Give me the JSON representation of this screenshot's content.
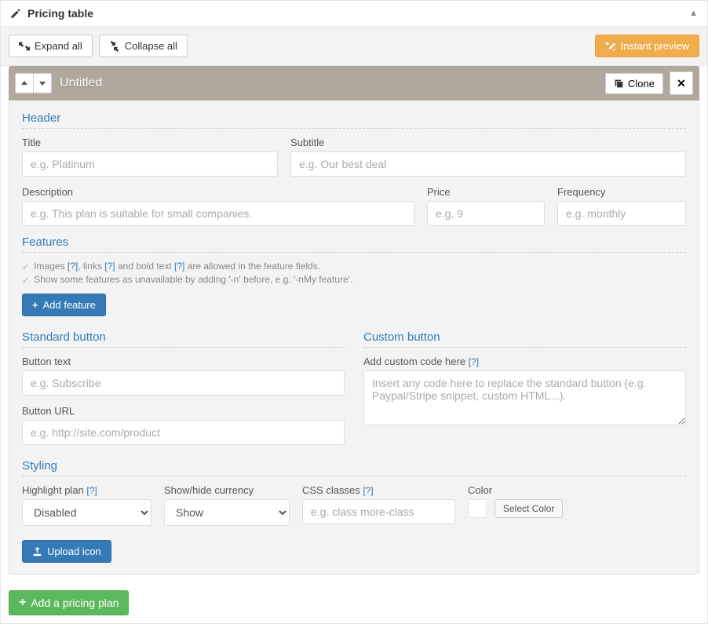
{
  "panel": {
    "title": "Pricing table"
  },
  "toolbar": {
    "expand": "Expand all",
    "collapse": "Collapse all",
    "preview": "Instant preview"
  },
  "plan": {
    "title": "Untitled",
    "clone": "Clone"
  },
  "sections": {
    "header": "Header",
    "features": "Features",
    "standard_button": "Standard button",
    "custom_button": "Custom button",
    "styling": "Styling"
  },
  "fields": {
    "title_label": "Title",
    "title_ph": "e.g. Platinum",
    "subtitle_label": "Subtitle",
    "subtitle_ph": "e.g. Our best deal",
    "description_label": "Description",
    "description_ph": "e.g. This plan is suitable for small companies.",
    "price_label": "Price",
    "price_ph": "e.g. 9",
    "frequency_label": "Frequency",
    "frequency_ph": "e.g. monthly",
    "button_text_label": "Button text",
    "button_text_ph": "e.g. Subscribe",
    "button_url_label": "Button URL",
    "button_url_ph": "e.g. http://site.com/product",
    "custom_code_label": "Add custom code here",
    "custom_code_ph": "Insert any code here to replace the standard button (e.g. Paypal/Stripe snippet, custom HTML...).",
    "highlight_label": "Highlight plan",
    "highlight_selected": "Disabled",
    "showhide_label": "Show/hide currency",
    "showhide_selected": "Show",
    "css_label": "CSS classes",
    "css_ph": "e.g. class more-class",
    "color_label": "Color",
    "select_color": "Select Color"
  },
  "hints": {
    "l1a": "Images",
    "l1b": ", links",
    "l1c": " and bold text",
    "l1d": " are allowed in the feature fields.",
    "l2": "Show some features as unavailable by adding '-n' before, e.g. '-nMy feature'.",
    "help": "[?]"
  },
  "buttons": {
    "add_feature": "Add feature",
    "upload_icon": "Upload icon",
    "add_plan": "Add a pricing plan"
  }
}
